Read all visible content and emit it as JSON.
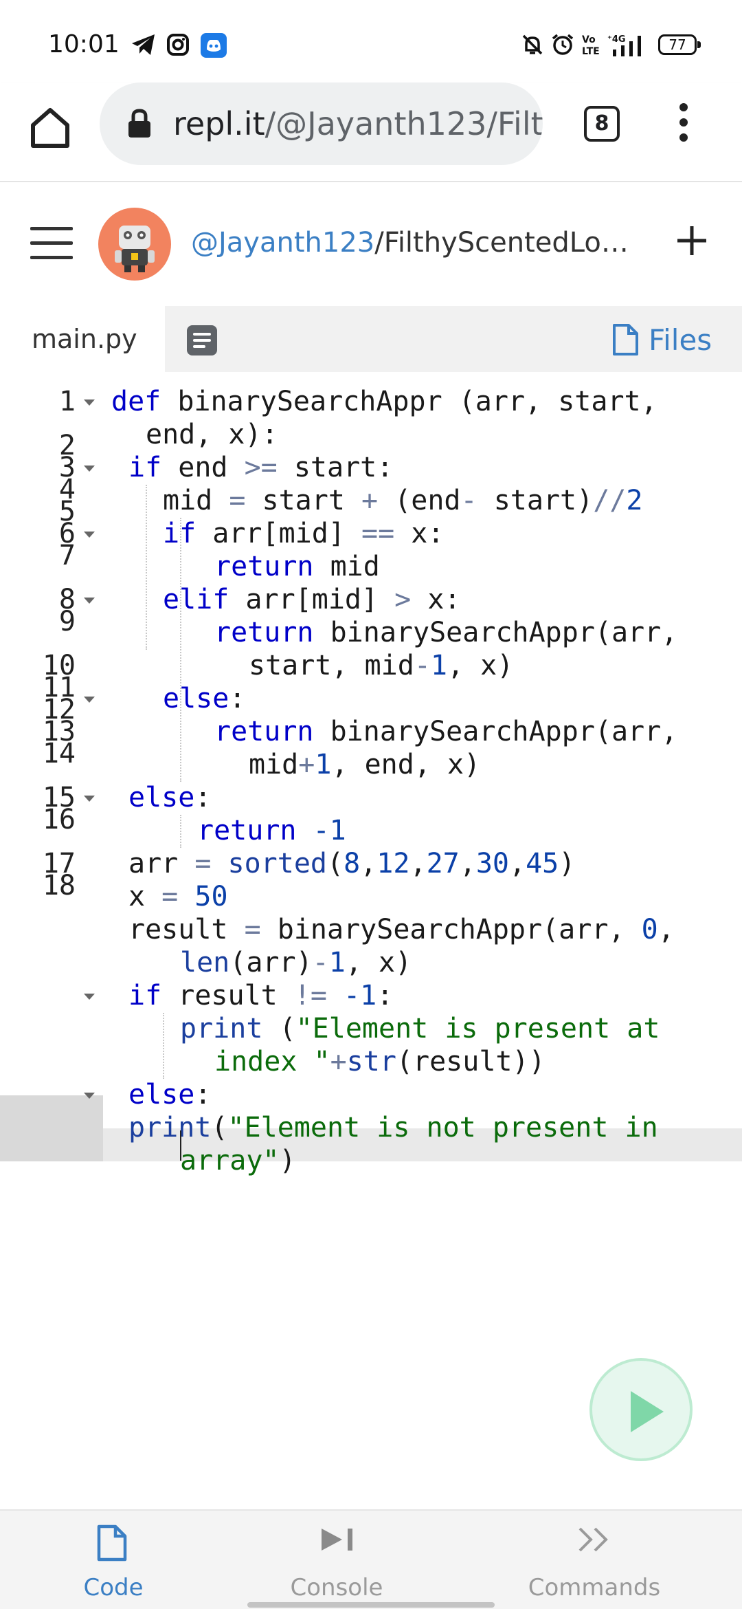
{
  "status_bar": {
    "time": "10:01",
    "battery": "77",
    "icons": [
      "telegram-icon",
      "instagram-icon",
      "discord-icon",
      "mute-bell-icon",
      "alarm-icon",
      "volte-icon",
      "4g-signal-icon",
      "battery-icon"
    ]
  },
  "browser": {
    "url_host": "repl.it",
    "url_path": "/@Jayanth123/Filt",
    "tab_count": "8"
  },
  "header": {
    "username": "@Jayanth123",
    "separator": "/",
    "repl_name": "FilthyScentedLoo..."
  },
  "file_tabs": {
    "active_file": "main.py",
    "files_label": "Files"
  },
  "editor": {
    "line_numbers": [
      "1",
      "2",
      "3",
      "4",
      "5",
      "6",
      "7",
      "8",
      "9",
      "10",
      "11",
      "12",
      "13",
      "14",
      "15",
      "16",
      "17",
      "18"
    ],
    "active_line": "18"
  },
  "bottom_nav": {
    "items": [
      {
        "label": "Code",
        "active": true
      },
      {
        "label": "Console",
        "active": false
      },
      {
        "label": "Commands",
        "active": false
      }
    ]
  },
  "colors": {
    "accent": "#3b7fc4",
    "avatar_bg": "#f2835f",
    "keyword": "#0000c8",
    "string": "#0b6b0b",
    "number": "#0b40a8",
    "run_button": "#7fd7a8"
  }
}
